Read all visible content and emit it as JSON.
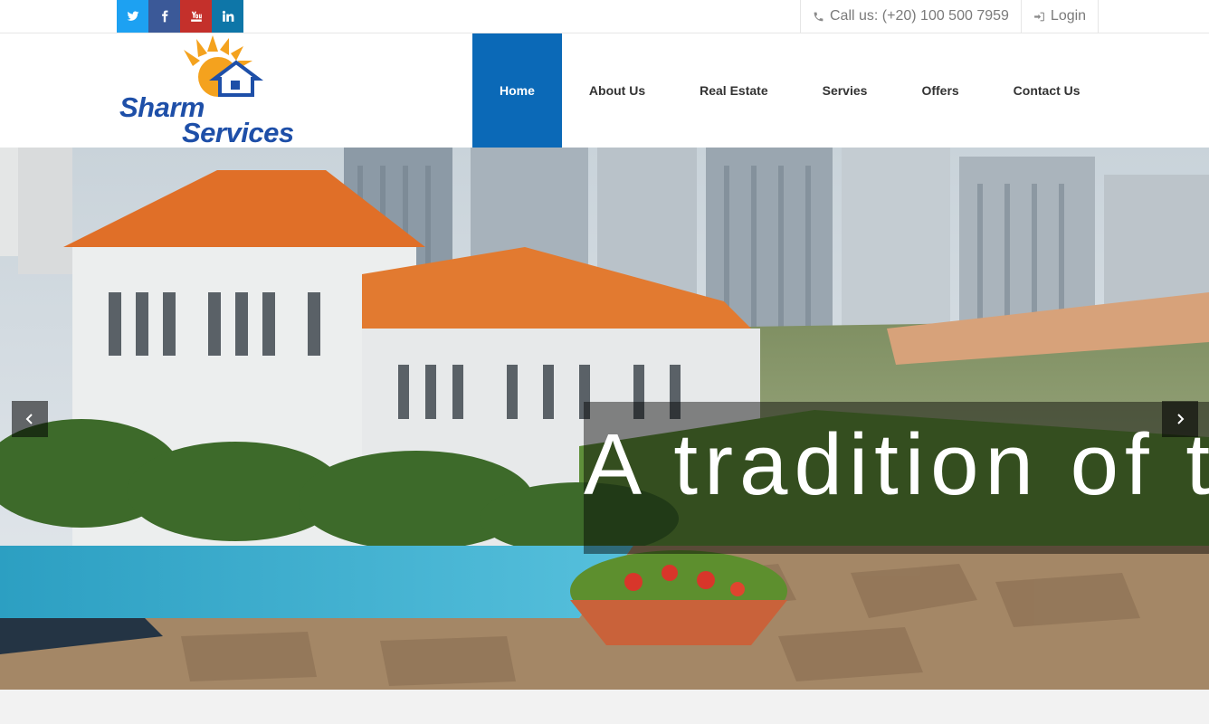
{
  "social": [
    {
      "name": "twitter",
      "icon": "twitter-icon",
      "color": "#1da1f2"
    },
    {
      "name": "facebook",
      "icon": "facebook-icon",
      "color": "#3b5998"
    },
    {
      "name": "youtube",
      "icon": "youtube-icon",
      "color": "#c4302b"
    },
    {
      "name": "linkedin",
      "icon": "linkedin-icon",
      "color": "#0e76a8"
    }
  ],
  "topbar": {
    "call_text": "Call us: (+20) 100 500 7959",
    "login_text": "Login"
  },
  "logo": {
    "word1": "Sharm",
    "word2": "Services"
  },
  "nav": {
    "items": [
      "Home",
      "About Us",
      "Real Estate",
      "Servies",
      "Offers",
      "Contact Us"
    ],
    "active": "Home",
    "active_color": "#0b69b7"
  },
  "hero": {
    "caption": "A tradition of trust"
  }
}
